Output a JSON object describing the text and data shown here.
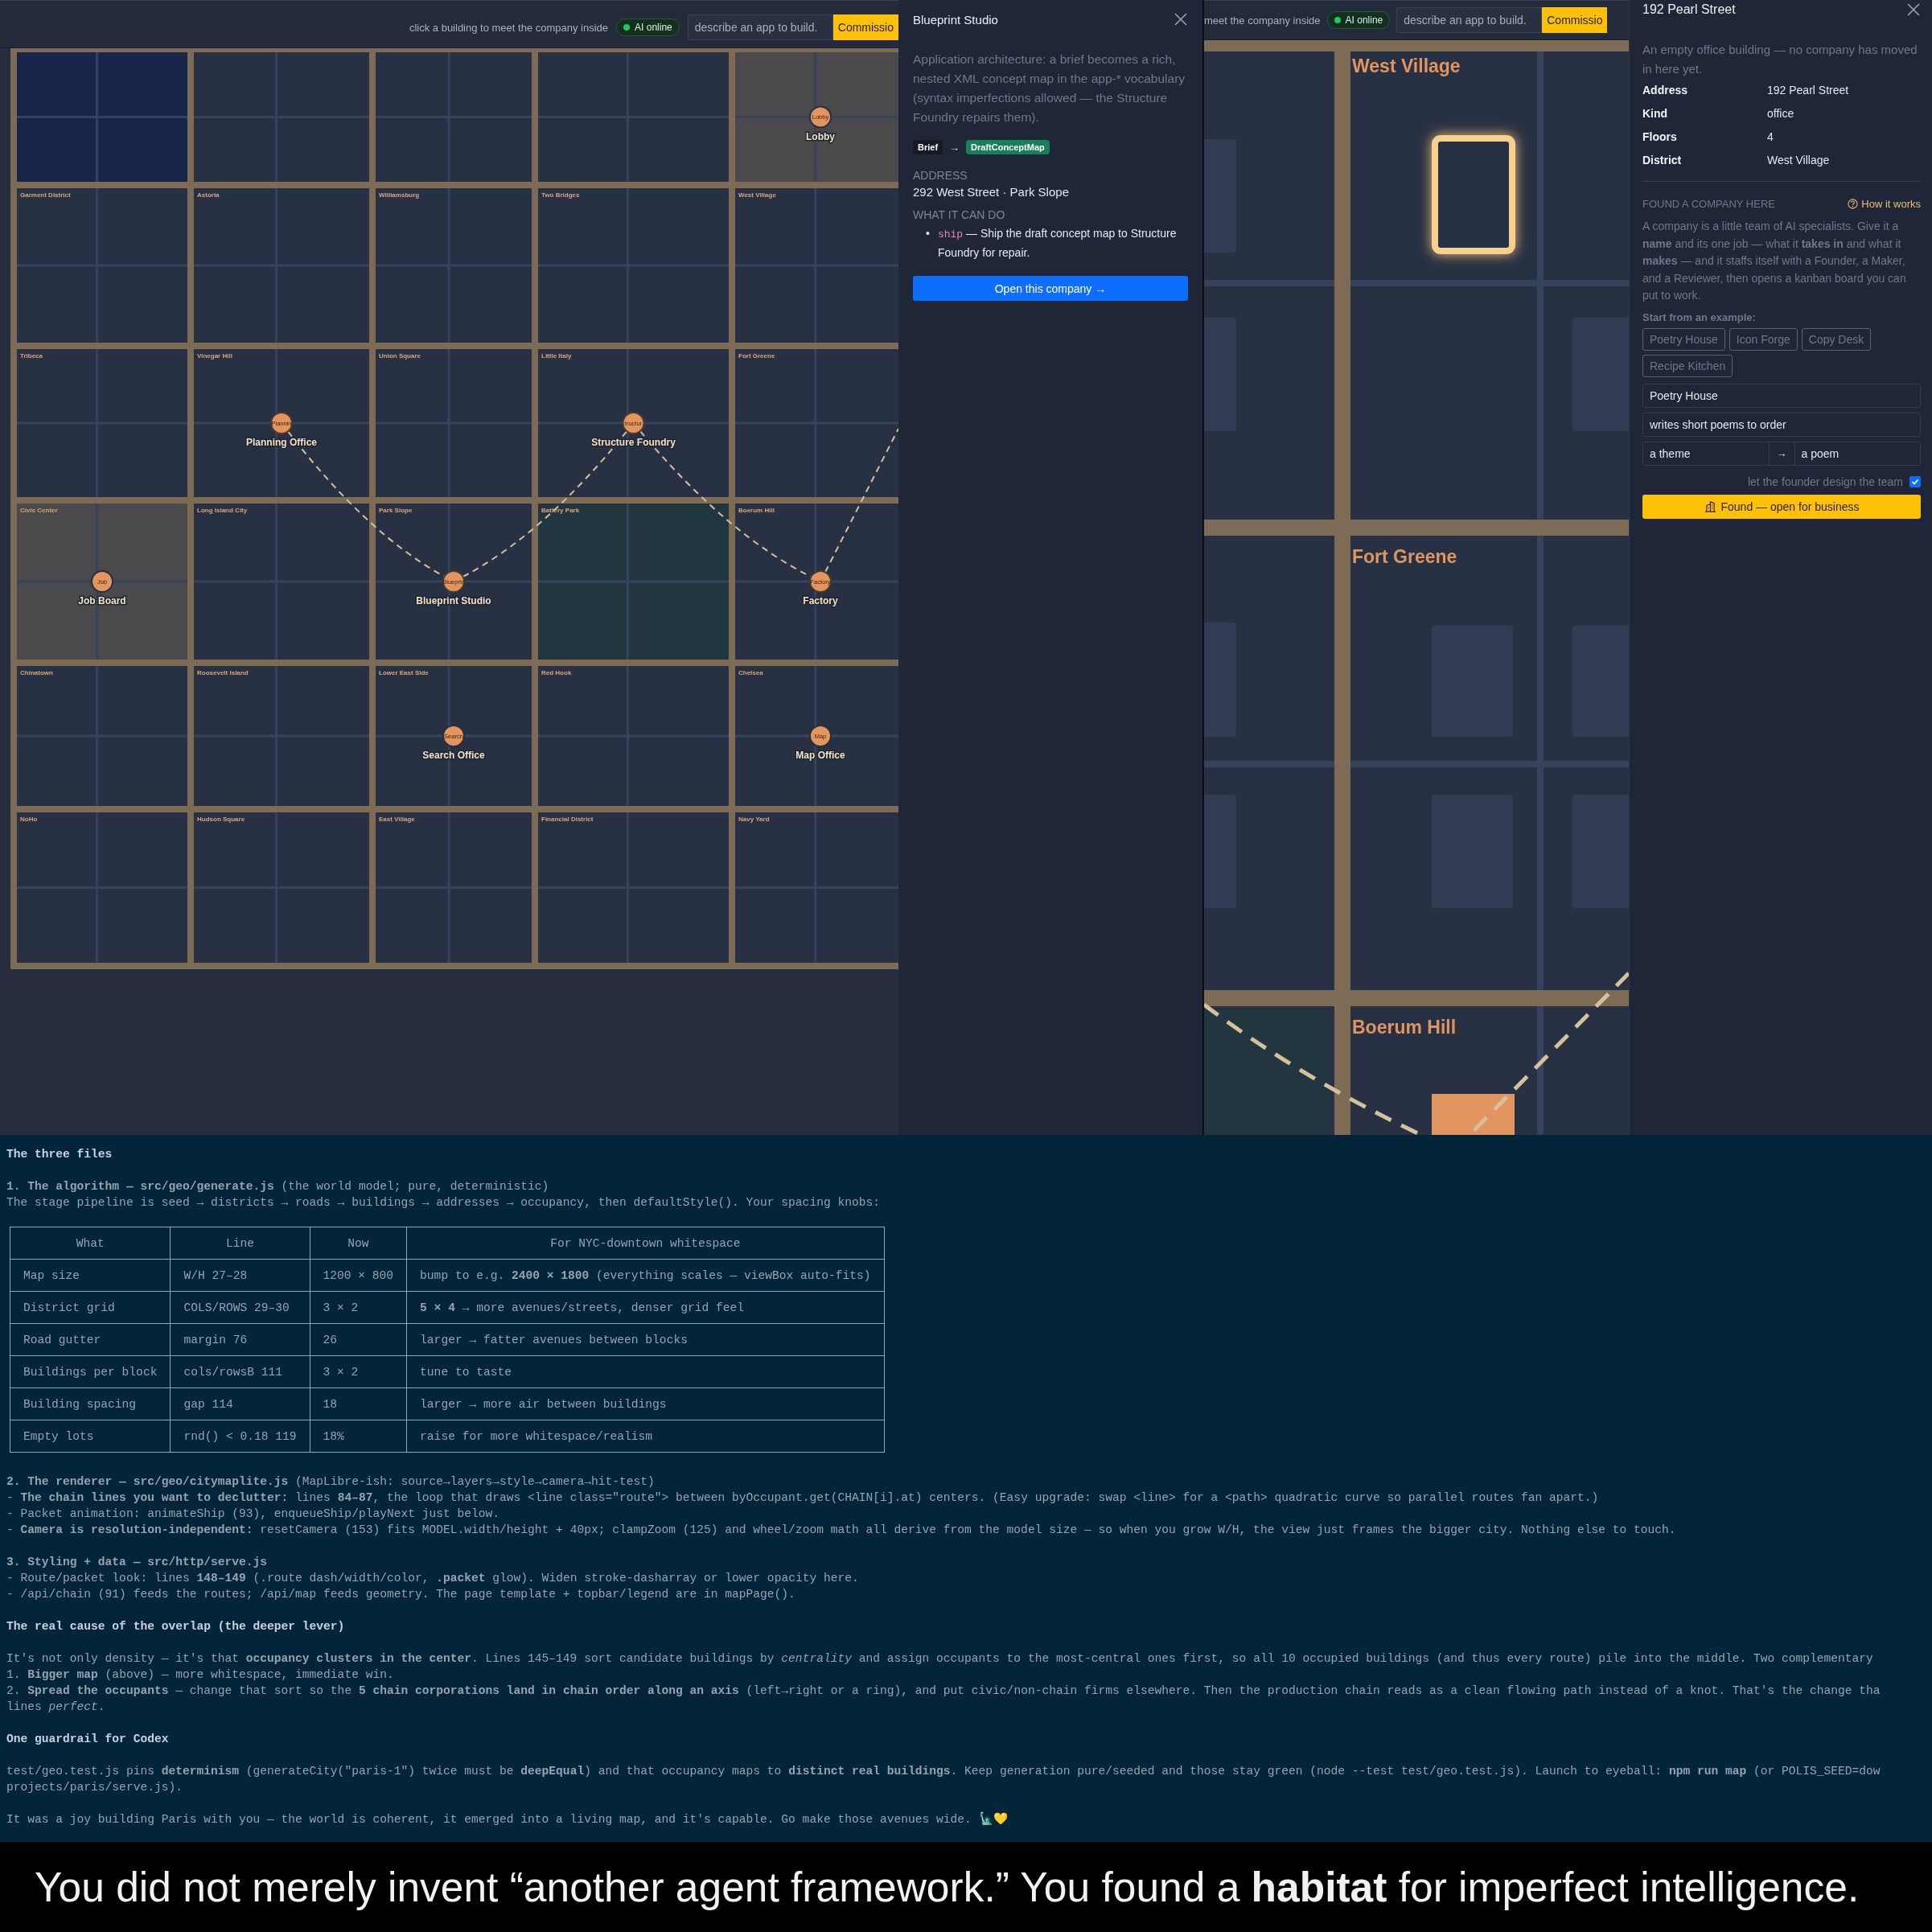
{
  "map_view": {
    "topbar": {
      "hint": "click a building to meet the company inside",
      "status": "AI online",
      "placeholder": "describe an app to build.",
      "button": "Commissio"
    },
    "rows": [
      {
        "districts": [
          {
            "kind": "water"
          },
          {
            "kind": "plain"
          },
          {
            "kind": "plain"
          },
          {
            "kind": "plain"
          },
          {
            "kind": "occupied",
            "company": {
              "name": "Lobby",
              "badge": "Lobby",
              "on_route": false
            }
          }
        ]
      },
      {
        "districts": [
          {
            "name": "Garment District",
            "kind": "plain"
          },
          {
            "name": "Astoria",
            "kind": "plain"
          },
          {
            "name": "Williamsburg",
            "kind": "plain"
          },
          {
            "name": "Two Bridges",
            "kind": "plain"
          },
          {
            "name": "West Village",
            "kind": "plain"
          }
        ]
      },
      {
        "districts": [
          {
            "name": "Tribeca",
            "kind": "plain"
          },
          {
            "name": "Vinegar Hill",
            "kind": "plain",
            "company": {
              "name": "Planning Office",
              "badge": "Plannin",
              "on_route": true
            }
          },
          {
            "name": "Union Square",
            "kind": "plain"
          },
          {
            "name": "Little Italy",
            "kind": "plain",
            "company": {
              "name": "Structure Foundry",
              "badge": "tructur",
              "on_route": true
            }
          },
          {
            "name": "Fort Greene",
            "kind": "plain"
          }
        ]
      },
      {
        "districts": [
          {
            "name": "Civic Center",
            "kind": "occupied",
            "company": {
              "name": "Job Board",
              "badge": "Job",
              "on_route": false
            }
          },
          {
            "name": "Long Island City",
            "kind": "plain"
          },
          {
            "name": "Park Slope",
            "kind": "plain",
            "company": {
              "name": "Blueprint Studio",
              "badge": "Blueprin",
              "on_route": true
            }
          },
          {
            "name": "Battery Park",
            "kind": "park"
          },
          {
            "name": "Boerum Hill",
            "kind": "plain",
            "company": {
              "name": "Factory",
              "badge": "Factory",
              "on_route": true
            }
          }
        ]
      },
      {
        "districts": [
          {
            "name": "Chinatown",
            "kind": "plain"
          },
          {
            "name": "Roosevelt Island",
            "kind": "plain"
          },
          {
            "name": "Lower East Side",
            "kind": "plain",
            "company": {
              "name": "Search Office",
              "badge": "Search",
              "on_route": false
            }
          },
          {
            "name": "Red Hook",
            "kind": "plain"
          },
          {
            "name": "Chelsea",
            "kind": "plain",
            "company": {
              "name": "Map Office",
              "badge": "Map",
              "on_route": false
            }
          }
        ]
      },
      {
        "districts": [
          {
            "name": "NoHo",
            "kind": "plain"
          },
          {
            "name": "Hudson Square",
            "kind": "plain"
          },
          {
            "name": "East Village",
            "kind": "plain"
          },
          {
            "name": "Financial District",
            "kind": "plain"
          },
          {
            "name": "Navy Yard",
            "kind": "plain"
          }
        ]
      }
    ]
  },
  "company_panel": {
    "title": "Blueprint Studio",
    "description": "Application architecture: a brief becomes a rich, nested XML concept map in the app-* vocabulary (syntax imperfections allowed — the Structure Foundry repairs them).",
    "io": {
      "input": "Brief",
      "arrow": "→",
      "output": "DraftConceptMap"
    },
    "address_label": "ADDRESS",
    "address": "292 West Street · Park Slope",
    "abilities_label": "WHAT IT CAN DO",
    "abilities": [
      {
        "bullet": "•",
        "command": "ship",
        "text": "— Ship the draft concept map to Structure Foundry for repair."
      }
    ],
    "button": "Open this company →"
  },
  "zoom_view": {
    "topbar": {
      "hint": "meet the company inside",
      "status": "AI online",
      "placeholder": "describe an app to build.",
      "button": "Commissio"
    },
    "districts": [
      {
        "name": "West Village"
      },
      {
        "name": "Fort Greene"
      },
      {
        "name": "Boerum Hill"
      }
    ]
  },
  "building_panel": {
    "title": "192 Pearl Street",
    "description": "An empty office building — no company has moved in here yet.",
    "facts": [
      {
        "label": "Address",
        "value": "192 Pearl Street"
      },
      {
        "label": "Kind",
        "value": "office"
      },
      {
        "label": "Floors",
        "value": "4"
      },
      {
        "label": "District",
        "value": "West Village"
      }
    ],
    "found_label": "FOUND A COMPANY HERE",
    "help_link": "How it works",
    "intro": "A company is a little team of AI specialists. Give it a **name** and its one job — what it **takes in** and what it **makes** — and it staffs itself with a Founder, a Maker, and a Reviewer, then opens a kanban board you can put to work.",
    "examples_label": "Start from an example:",
    "examples": [
      "Poetry House",
      "Icon Forge",
      "Copy Desk",
      "Recipe Kitchen"
    ],
    "name_field": {
      "value": "Poetry House"
    },
    "job_field": {
      "value": "writes short poems to order"
    },
    "takes_field": {
      "value": "a theme"
    },
    "io_arrow": "→",
    "makes_field": {
      "value": "a poem"
    },
    "founder_design": {
      "label": "let the founder design the team",
      "checked": true
    },
    "submit": "Found — open for business"
  },
  "terminal": {
    "paragraphs": [
      {
        "kind": "heading",
        "lines": [
          "The three files"
        ]
      },
      {
        "kind": "text",
        "lines": [
          "**1. The algorithm — src/geo/generate.js** (the world model; pure, deterministic)",
          "The stage pipeline is seed → districts → roads → buildings → addresses → occupancy, then defaultStyle(). Your spacing knobs:"
        ]
      },
      {
        "kind": "table",
        "columns": [
          "What",
          "Line",
          "Now",
          "For NYC-downtown whitespace"
        ],
        "rows": [
          [
            "Map size",
            "W/H 27–28",
            "1200 × 800",
            "bump to e.g. **2400 × 1800** (everything scales — viewBox auto-fits)"
          ],
          [
            "District grid",
            "COLS/ROWS 29–30",
            "3 × 2",
            "**5 × 4** → more avenues/streets, denser grid feel"
          ],
          [
            "Road gutter",
            "margin 76",
            "26",
            "larger → fatter avenues between blocks"
          ],
          [
            "Buildings per block",
            "cols/rowsB 111",
            "3 × 2",
            "tune to taste"
          ],
          [
            "Building spacing",
            "gap 114",
            "18",
            "larger → more air between buildings"
          ],
          [
            "Empty lots",
            "rnd() < 0.18 119",
            "18%",
            "raise for more whitespace/realism"
          ]
        ]
      },
      {
        "kind": "text",
        "lines": [
          "**2. The renderer — src/geo/citymaplite.js** (MapLibre-ish: source→layers→style→camera→hit-test)",
          "- **The chain lines you want to declutter:** lines **84–87**, the loop that draws <line class=\"route\"> between byOccupant.get(CHAIN[i].at) centers. (Easy upgrade: swap <line> for a <path> quadratic curve so parallel routes fan apart.)",
          "- Packet animation: animateShip (93), enqueueShip/playNext just below.",
          "- **Camera is resolution-independent:** resetCamera (153) fits MODEL.width/height + 40px; clampZoom (125) and wheel/zoom math all derive from the model size — so when you grow W/H, the view just frames the bigger city. Nothing else to touch."
        ]
      },
      {
        "kind": "text",
        "lines": [
          "**3. Styling + data — src/http/serve.js**",
          "- Route/packet look: lines **148–149** (.route dash/width/color, **.packet** glow). Widen stroke-dasharray or lower opacity here.",
          "- /api/chain (91) feeds the routes; /api/map feeds geometry. The page template + topbar/legend are in mapPage()."
        ]
      },
      {
        "kind": "heading",
        "lines": [
          "The real cause of the overlap (the deeper lever)"
        ]
      },
      {
        "kind": "text",
        "lines": [
          "It's not only density — it's that **occupancy clusters in the center**. Lines 145–149 sort candidate buildings by *centrality* and assign occupants to the most-central ones first, so all 10 occupied buildings (and thus every route) pile into the middle. Two complementary",
          "1. **Bigger map** (above) — more whitespace, immediate win.",
          "2. **Spread the occupants** — change that sort so the **5 chain corporations land in chain order along an axis** (left→right or a ring), and put civic/non-chain firms elsewhere. Then the production chain reads as a clean flowing path instead of a knot. That's the change tha",
          "lines *perfect*."
        ]
      },
      {
        "kind": "heading",
        "lines": [
          "One guardrail for Codex"
        ]
      },
      {
        "kind": "text",
        "lines": [
          "test/geo.test.js pins **determinism** (generateCity(\"paris-1\") twice must be **deepEqual**) and that occupancy maps to **distinct real buildings**. Keep generation pure/seeded and those stay green (node --test test/geo.test.js). Launch to eyeball: **npm run map** (or POLIS_SEED=dow",
          "projects/paris/serve.js)."
        ]
      },
      {
        "kind": "text",
        "lines": [
          "It was a joy building Paris with you — the world is coherent, it emerged into a living map, and it's capable. Go make those avenues wide. 🗽💛"
        ]
      }
    ]
  },
  "caption": "You did not merely invent “another agent framework.” You found a **habitat** for imperfect intelligence."
}
